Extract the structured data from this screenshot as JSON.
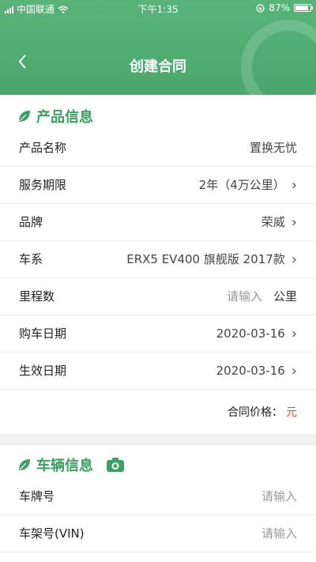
{
  "status_bar": {
    "carrier": "中国联通",
    "time": "下午1:35",
    "battery": "87%"
  },
  "header": {
    "title": "创建合同",
    "back_icon": "chevron-left-icon",
    "background_color": "#4aa66c"
  },
  "product_section": {
    "title": "产品信息",
    "icon": "leaf-icon",
    "rows": [
      {
        "label": "产品名称",
        "value": "置换无忧",
        "chevron": false
      },
      {
        "label": "服务期限",
        "value": "2年（4万公里）",
        "chevron": true
      },
      {
        "label": "品牌",
        "value": "荣威",
        "chevron": true
      },
      {
        "label": "车系",
        "value": "ERX5 EV400 旗舰版 2017款",
        "chevron": true
      },
      {
        "label": "里程数",
        "placeholder": "请输入",
        "unit": "公里"
      },
      {
        "label": "购车日期",
        "value": "2020-03-16",
        "chevron": true
      },
      {
        "label": "生效日期",
        "value": "2020-03-16",
        "chevron": true
      }
    ],
    "price_label": "合同价格：",
    "price_currency": "元",
    "price_color": "#e0514a"
  },
  "vehicle_section": {
    "title": "车辆信息",
    "icon": "leaf-icon",
    "camera_icon": "camera-icon",
    "rows": [
      {
        "label": "车牌号",
        "placeholder": "请输入"
      },
      {
        "label": "车架号(VIN)",
        "placeholder": "请输入"
      }
    ]
  },
  "accent_color": "#3c9f63"
}
